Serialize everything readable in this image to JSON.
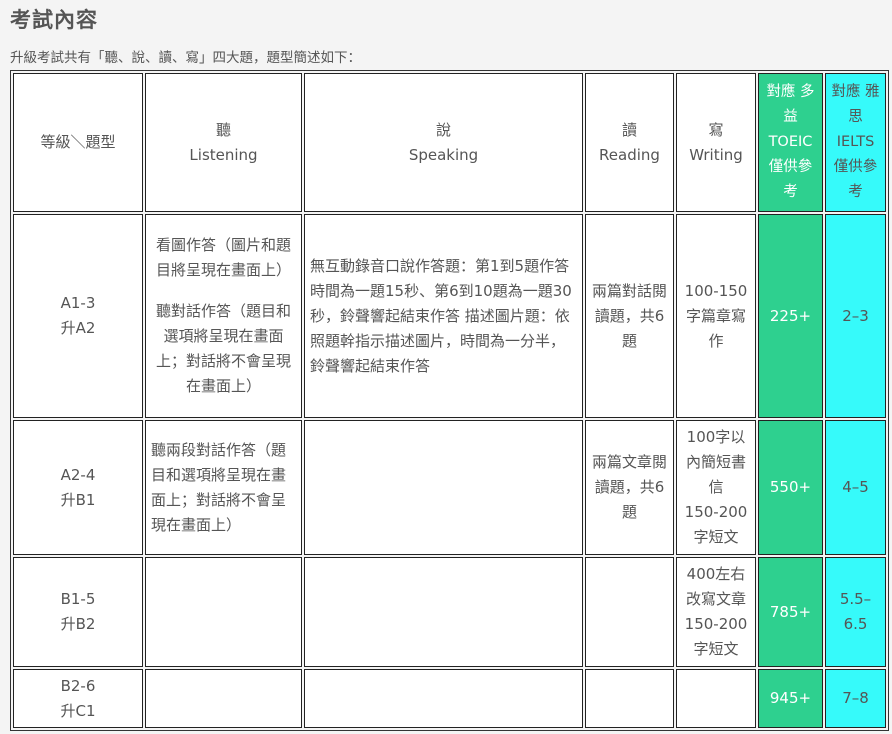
{
  "page": {
    "title": "考試內容",
    "intro": "升級考試共有「聽、說、讀、寫」四大題，題型簡述如下："
  },
  "table": {
    "header": {
      "level": "等級＼題型",
      "listening_zh": "聽",
      "listening_en": "Listening",
      "speaking_zh": "說",
      "speaking_en": "Speaking",
      "reading_zh": "讀",
      "reading_en": "Reading",
      "writing_zh": "寫",
      "writing_en": "Writing",
      "toeic": "對應 多益 TOEIC 僅供參考",
      "ielts": "對應 雅思 IELTS 僅供參考"
    },
    "rows": [
      {
        "level": "A1-3",
        "upgrade": "升A2",
        "listening_1": "看圖作答（圖片和題目將呈現在畫面上）",
        "listening_2": "聽對話作答（題目和選項將呈現在畫面上；對話將不會呈現在畫面上）",
        "speaking": "無互動錄音口說作答題：第1到5題作答時間為一題15秒、第6到10題為一題30秒，鈴聲響起結束作答 描述圖片題：依照題幹指示描述圖片，時間為一分半，鈴聲響起結束作答",
        "reading": "兩篇對話閱讀題，共6題",
        "writing": "100-150字篇章寫作",
        "toeic": "225+",
        "ielts": "2–3"
      },
      {
        "level": "A2-4",
        "upgrade": "升B1",
        "listening": "聽兩段對話作答（題目和選項將呈現在畫面上；對話將不會呈現在畫面上）",
        "speaking": "",
        "reading": "兩篇文章閱讀題，共6題",
        "writing_1": "100字以內簡短書信",
        "writing_2": "150-200字短文",
        "toeic": "550+",
        "ielts": "4–5"
      },
      {
        "level": "B1-5",
        "upgrade": "升B2",
        "listening": "",
        "speaking": "",
        "reading": "",
        "writing_1": "400左右改寫文章",
        "writing_2": "150-200字短文",
        "toeic": "785+",
        "ielts": "5.5–6.5"
      },
      {
        "level": "B2-6",
        "upgrade": "升C1",
        "listening": "",
        "speaking": "",
        "reading": "",
        "writing": "",
        "toeic": "945+",
        "ielts": "7–8"
      }
    ]
  },
  "colors": {
    "toeic_column": "#2ed08f",
    "ielts_column": "#36fafa"
  }
}
